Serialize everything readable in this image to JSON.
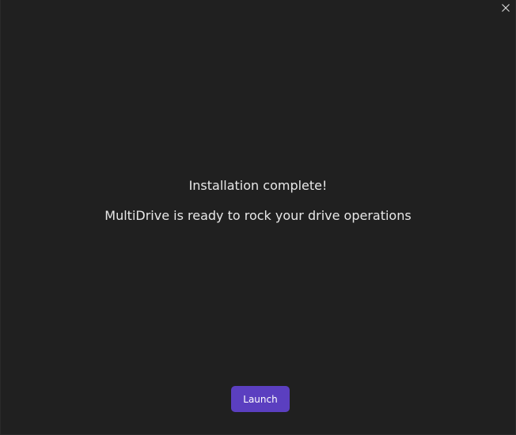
{
  "window": {
    "close_icon": "close-icon"
  },
  "message": {
    "title": "Installation complete!",
    "subtitle": "MultiDrive is ready to rock your drive operations"
  },
  "actions": {
    "launch_label": "Launch"
  },
  "colors": {
    "background": "#202020",
    "accent": "#5b3fc0",
    "text": "#e8e8e8"
  }
}
